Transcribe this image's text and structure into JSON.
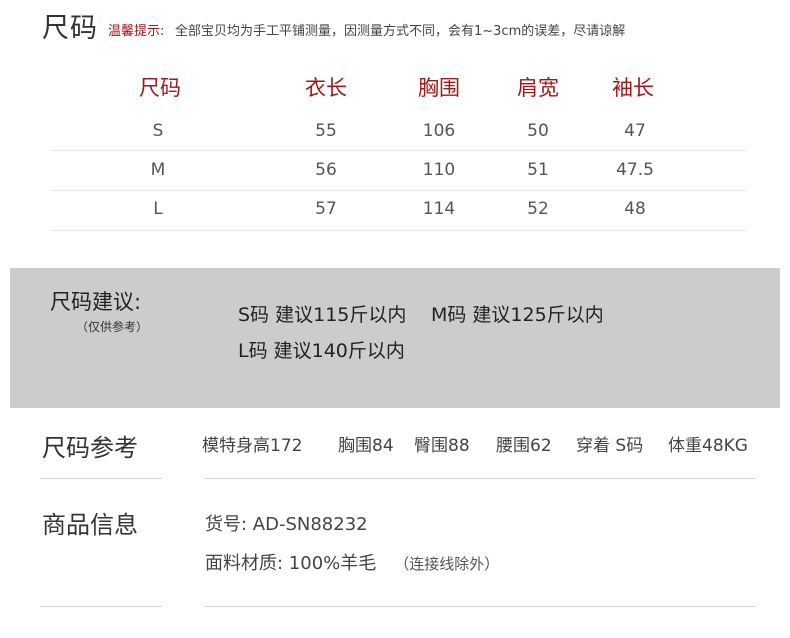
{
  "header": {
    "title": "尺码",
    "tip_label": "温馨提示:",
    "tip_text": "全部宝贝均为手工平铺测量，因测量方式不同，会有1~3cm的误差，尽请谅解"
  },
  "size_table": {
    "headers": [
      "尺码",
      "衣长",
      "胸围",
      "肩宽",
      "袖长"
    ],
    "rows": [
      [
        "S",
        "55",
        "106",
        "50",
        "47"
      ],
      [
        "M",
        "56",
        "110",
        "51",
        "47.5"
      ],
      [
        "L",
        "57",
        "114",
        "52",
        "48"
      ]
    ]
  },
  "recommendation": {
    "title": "尺码建议:",
    "subtitle": "（仅供参考）",
    "line1_a": "S码 建议115斤以内",
    "line1_b": "M码 建议125斤以内",
    "line2": "L码 建议140斤以内"
  },
  "reference": {
    "title": "尺码参考",
    "items": [
      "模特身高172",
      "胸围84",
      "臀围88",
      "腰围62",
      "穿着 S码",
      "体重48KG"
    ]
  },
  "product_info": {
    "title": "商品信息",
    "sku": "货号: AD-SN88232",
    "material": "面料材质: 100%羊毛",
    "material_note": "（连接线除外）"
  },
  "colors": {
    "accent_red": "#a31818",
    "panel_gray": "#cccccc"
  }
}
